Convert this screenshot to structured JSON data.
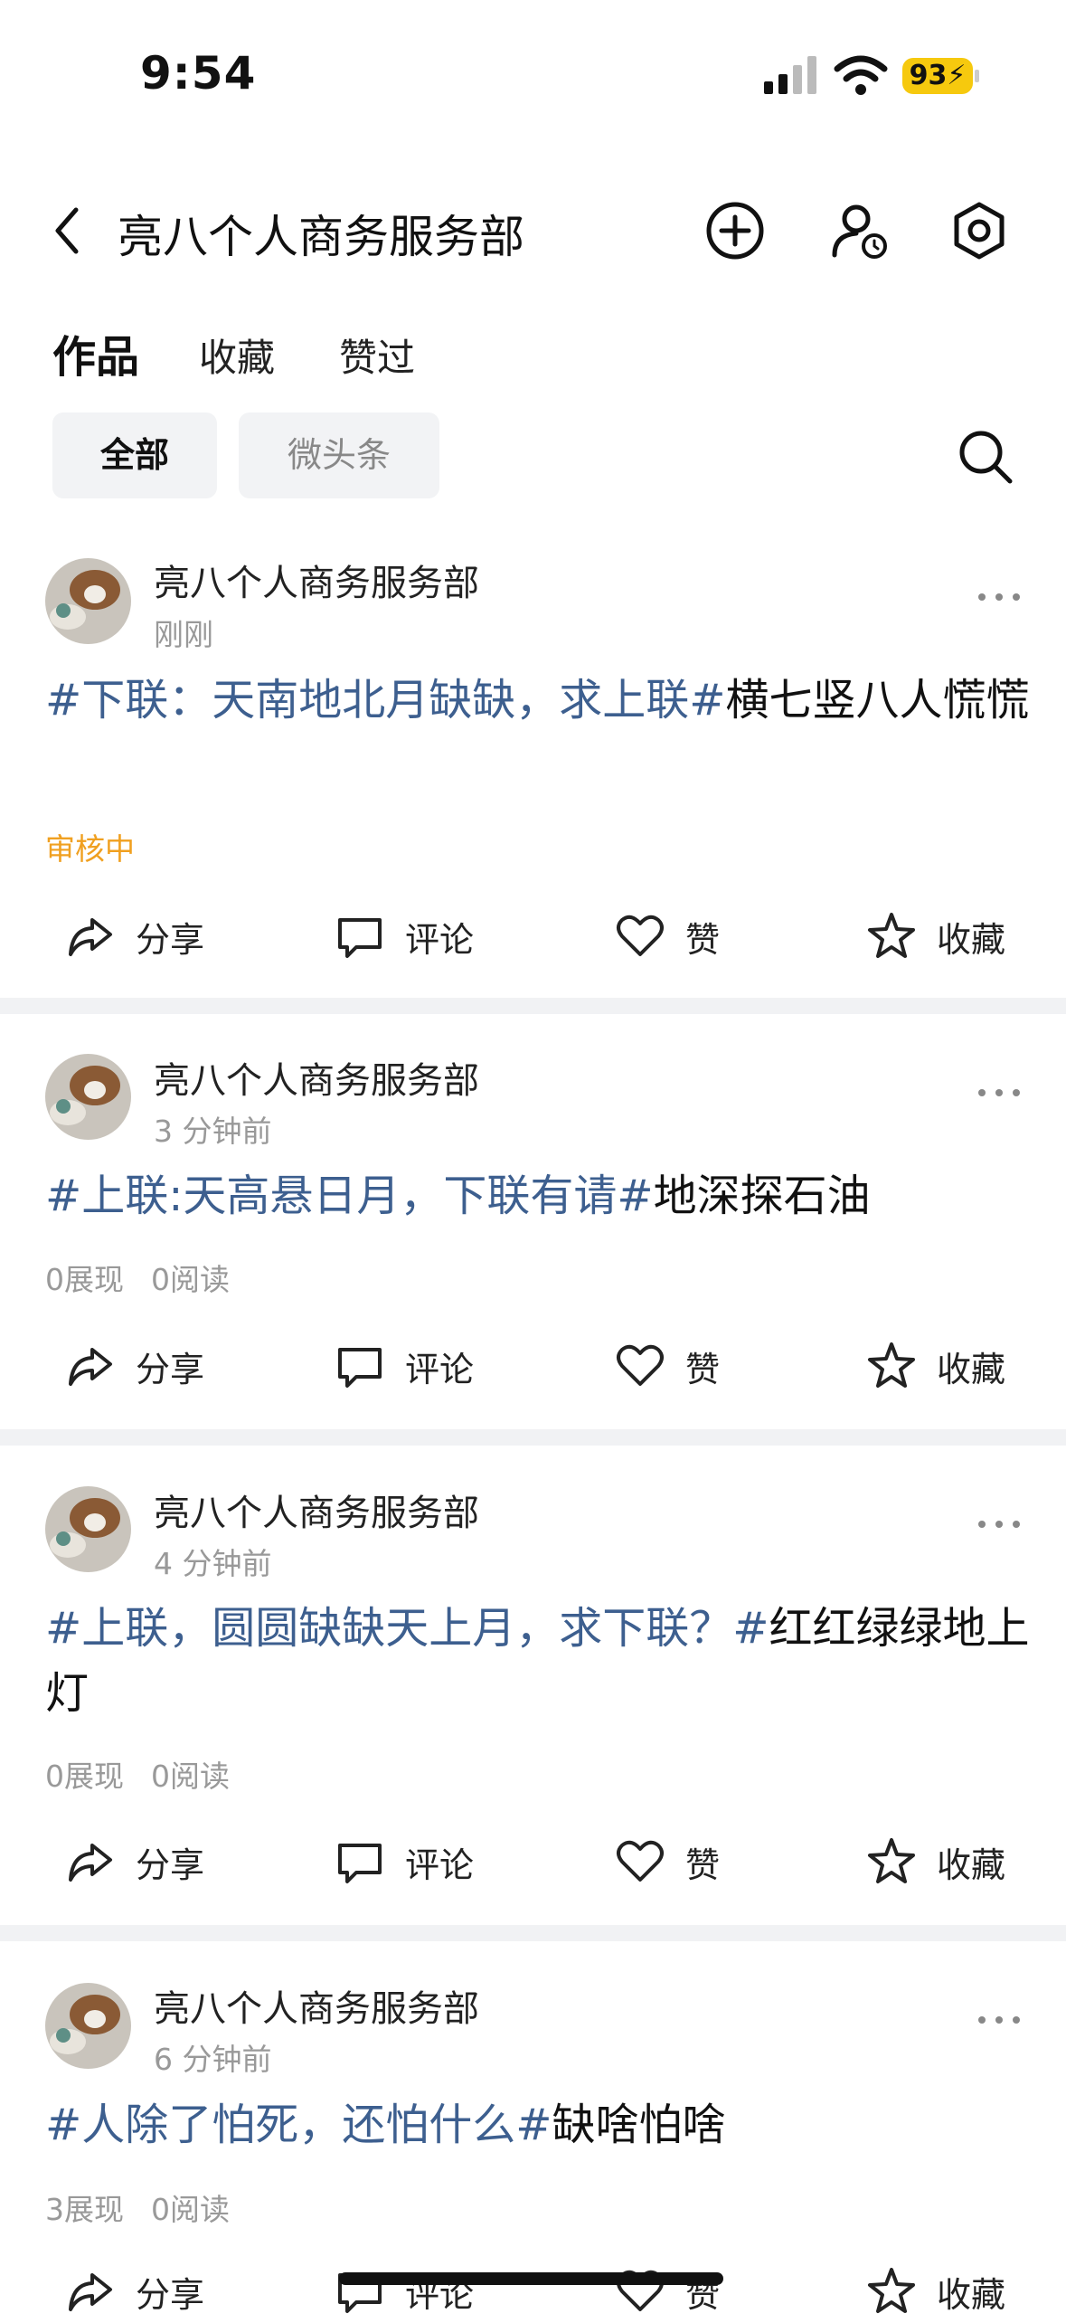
{
  "status_bar": {
    "time": "9:54",
    "battery": "93"
  },
  "header": {
    "title": "亮八个人商务服务部"
  },
  "tabs": [
    "作品",
    "收藏",
    "赞过"
  ],
  "filters": [
    "全部",
    "微头条"
  ],
  "actions": {
    "share": "分享",
    "comment": "评论",
    "like": "赞",
    "favorite": "收藏"
  },
  "posts": [
    {
      "author": "亮八个人商务服务部",
      "time": "刚刚",
      "tag_text": "#下联：天南地北月缺缺，求上联#",
      "plain_text": "横七竖八人慌慌",
      "review_status": "审核中"
    },
    {
      "author": "亮八个人商务服务部",
      "time": "3 分钟前",
      "tag_text": "#上联:天高悬日月，下联有请#",
      "plain_text": "地深探石油",
      "stats": {
        "views": "0展现",
        "reads": "0阅读"
      }
    },
    {
      "author": "亮八个人商务服务部",
      "time": "4 分钟前",
      "tag_text": "#上联，圆圆缺缺天上月，求下联？#",
      "plain_text": "红红绿绿地上灯",
      "stats": {
        "views": "0展现",
        "reads": "0阅读"
      }
    },
    {
      "author": "亮八个人商务服务部",
      "time": "6 分钟前",
      "tag_text": "#人除了怕死，还怕什么#",
      "plain_text": "缺啥怕啥",
      "stats": {
        "views": "3展现",
        "reads": "0阅读"
      }
    }
  ]
}
